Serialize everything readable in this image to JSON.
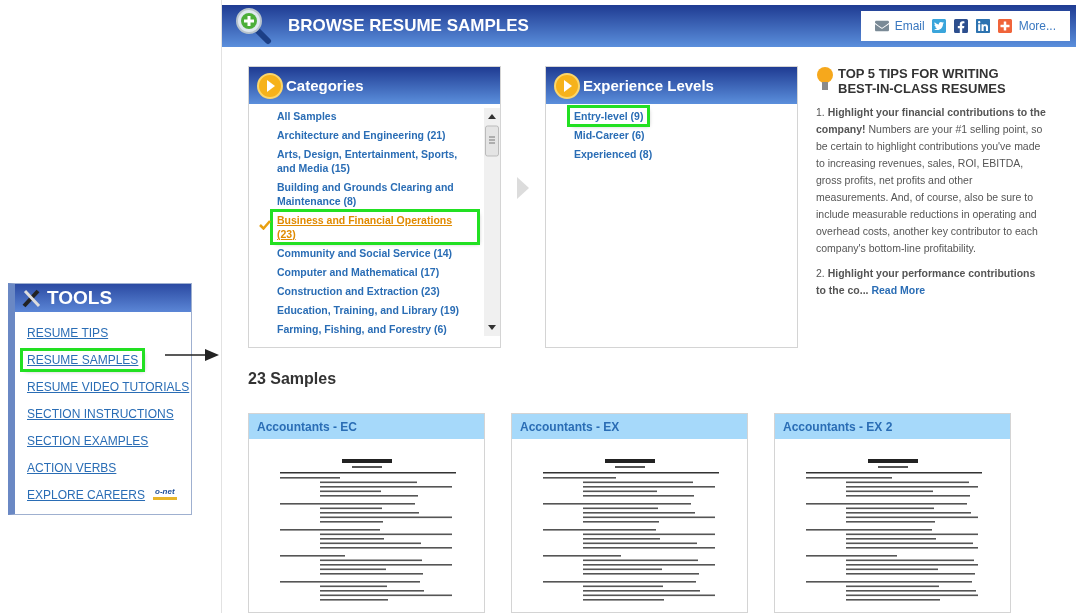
{
  "tools": {
    "title": "TOOLS",
    "items": [
      {
        "label": "RESUME TIPS",
        "highlighted": false
      },
      {
        "label": "RESUME SAMPLES",
        "highlighted": true
      },
      {
        "label": "RESUME VIDEO TUTORIALS",
        "highlighted": false
      },
      {
        "label": "SECTION INSTRUCTIONS",
        "highlighted": false
      },
      {
        "label": "SECTION EXAMPLES",
        "highlighted": false
      },
      {
        "label": "ACTION VERBS",
        "highlighted": false
      },
      {
        "label": "EXPLORE CAREERS",
        "highlighted": false,
        "badge": "o-net"
      }
    ]
  },
  "header": {
    "title": "BROWSE RESUME SAMPLES",
    "share": {
      "email": "Email",
      "more": "More..."
    }
  },
  "categories": {
    "title": "Categories",
    "items": [
      {
        "label": "All Samples",
        "selected": false,
        "highlighted": false
      },
      {
        "label": "Architecture and Engineering (21)",
        "selected": false,
        "highlighted": false
      },
      {
        "label": "Arts, Design, Entertainment, Sports, and Media (15)",
        "selected": false,
        "highlighted": false
      },
      {
        "label": "Building and Grounds Clearing and Maintenance (8)",
        "selected": false,
        "highlighted": false
      },
      {
        "label": "Business and Financial Operations (23)",
        "selected": true,
        "highlighted": true
      },
      {
        "label": "Community and Social Service (14)",
        "selected": false,
        "highlighted": false
      },
      {
        "label": "Computer and Mathematical (17)",
        "selected": false,
        "highlighted": false
      },
      {
        "label": "Construction and Extraction (23)",
        "selected": false,
        "highlighted": false
      },
      {
        "label": "Education, Training, and Library (19)",
        "selected": false,
        "highlighted": false
      },
      {
        "label": "Farming, Fishing, and Forestry (6)",
        "selected": false,
        "highlighted": false
      }
    ]
  },
  "experience": {
    "title": "Experience Levels",
    "items": [
      {
        "label": "Entry-level (9)",
        "highlighted": true
      },
      {
        "label": "Mid-Career (6)",
        "highlighted": false
      },
      {
        "label": "Experienced (8)",
        "highlighted": false
      }
    ]
  },
  "tips": {
    "title": "TOP 5 TIPS FOR WRITING BEST-IN-CLASS RESUMES",
    "paragraphs": [
      "1. **Highlight your financial contributions to the company!** Numbers are your #1 selling point, so be certain to highlight contributions you've made to increasing revenues, sales, ROI, EBITDA, gross profits, net profits and other measurements. And, of course, also be sure to include measurable reductions in operating and overhead costs, another key contributor to each company's bottom-line profitability.",
      "2. **Highlight your performance contributions to the co...**"
    ],
    "read_more": "Read More"
  },
  "samples": {
    "count": "23 Samples",
    "cards": [
      {
        "title": "Accountants - EC"
      },
      {
        "title": "Accountants - EX"
      },
      {
        "title": "Accountants - EX 2"
      }
    ]
  }
}
